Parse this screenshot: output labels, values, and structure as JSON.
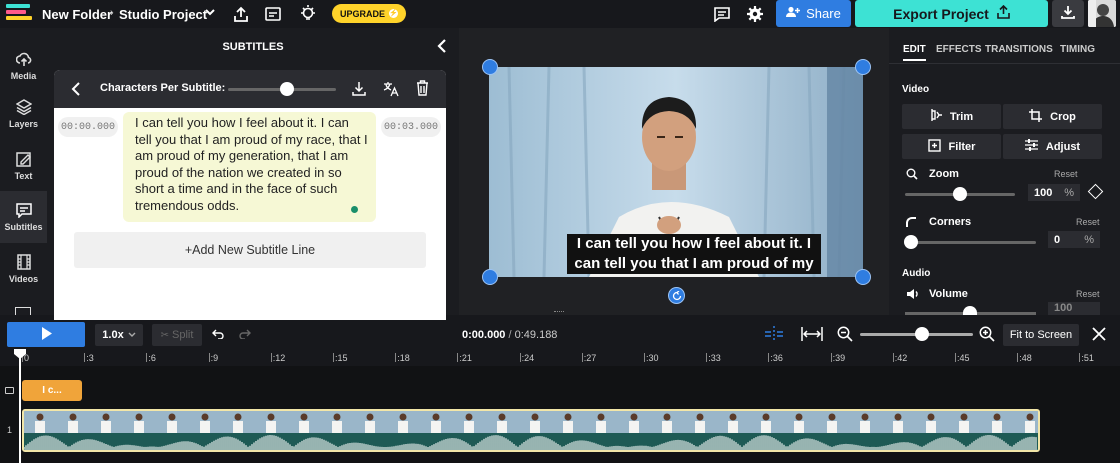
{
  "topbar": {
    "folder": "New Folder",
    "project": "Studio Project",
    "upgrade_label": "UPGRADE",
    "share_label": "Share",
    "export_label": "Export Project"
  },
  "leftnav": {
    "items": [
      {
        "label": "Media",
        "icon": "upload-icon"
      },
      {
        "label": "Layers",
        "icon": "layers-icon"
      },
      {
        "label": "Text",
        "icon": "text-icon"
      },
      {
        "label": "Subtitles",
        "icon": "subtitles-icon"
      },
      {
        "label": "Videos",
        "icon": "film-icon"
      }
    ]
  },
  "subtitles_panel": {
    "title": "SUBTITLES",
    "chars_label": "Characters Per Subtitle:",
    "chars_per_subtitle_fraction": 0.55,
    "entry": {
      "start": "00:00.000",
      "end": "00:03.000",
      "text": "I can tell you how I feel about it. I can tell you that I am proud of my race, that I am proud of my generation, that I am proud of the nation we created in so short a time and in the face of such tremendous odds."
    },
    "add_line_label": "+Add New Subtitle Line"
  },
  "preview": {
    "caption": "I can tell you how I feel about it. I can tell you that I am proud of my"
  },
  "right_panel": {
    "tabs": [
      "EDIT",
      "EFFECTS",
      "TRANSITIONS",
      "TIMING"
    ],
    "video_section": "Video",
    "buttons": [
      "Trim",
      "Crop",
      "Filter",
      "Adjust"
    ],
    "zoom_label": "Zoom",
    "zoom_value": "100",
    "zoom_unit": "%",
    "reset_label": "Reset",
    "corners_label": "Corners",
    "corners_value": "0",
    "corners_unit": "%",
    "audio_section": "Audio",
    "volume_label": "Volume",
    "volume_value": "100"
  },
  "timeline": {
    "speed": "1.0x",
    "split_label": "Split",
    "current_time": "0:00.000",
    "total_time": "0:49.188",
    "time_separator": " / ",
    "fit_label": "Fit to Screen",
    "ticks": [
      "0",
      ":3",
      ":6",
      ":9",
      ":12",
      ":15",
      ":18",
      ":21",
      ":24",
      ":27",
      ":30",
      ":33",
      ":36",
      ":39",
      ":42",
      ":45",
      ":48",
      ":51"
    ],
    "subtitle_clip_label": "I c...",
    "track_numbers": [
      "1"
    ]
  },
  "colors": {
    "accent_blue": "#2f7de1",
    "export_teal": "#3de2d4",
    "upgrade_yellow": "#ffd32a",
    "subtitle_clip": "#f0a43a"
  }
}
